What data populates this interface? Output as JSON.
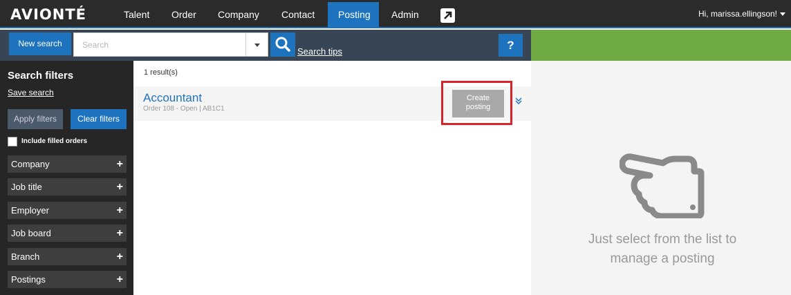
{
  "header": {
    "logo": "AVIONTÉ",
    "nav": [
      {
        "label": "Talent",
        "active": false
      },
      {
        "label": "Order",
        "active": false
      },
      {
        "label": "Company",
        "active": false
      },
      {
        "label": "Contact",
        "active": false
      },
      {
        "label": "Posting",
        "active": true
      },
      {
        "label": "Admin",
        "active": false
      }
    ],
    "external_icon": "arrow-up-right-icon",
    "user_greeting": "Hi, marissa.ellingson!"
  },
  "searchbar": {
    "new_search_label": "New search",
    "placeholder": "Search",
    "search_tips_label": "Search tips",
    "help_label": "?"
  },
  "sidebar": {
    "title": "Search filters",
    "save_search": "Save search",
    "apply_filters": "Apply filters",
    "clear_filters": "Clear filters",
    "include_filled_label": "Include filled orders",
    "include_filled_checked": false,
    "filters": [
      "Company",
      "Job title",
      "Employer",
      "Job board",
      "Branch",
      "Postings"
    ]
  },
  "results": {
    "count_text": "1 result(s)",
    "items": [
      {
        "title": "Accountant",
        "subtitle": "Order 108 - Open | AB1C1",
        "create_label_line1": "Create",
        "create_label_line2": "posting"
      }
    ]
  },
  "right_panel": {
    "message": "Just select from the list to manage a posting"
  },
  "colors": {
    "nav_bg": "#2b2b2b",
    "accent": "#1e73be",
    "search_bg": "#384554",
    "green": "#6faa44",
    "highlight": "#d9222a"
  }
}
